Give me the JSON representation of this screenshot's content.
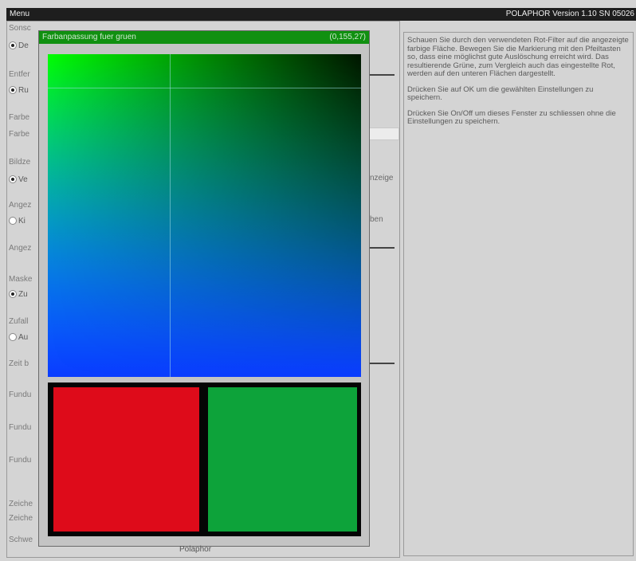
{
  "titlebar": {
    "menu_label": "Menu",
    "version_text": "POLAPHOR Version 1.10 SN 05026"
  },
  "background_labels": [
    "Sonsc",
    "Entfer",
    "Farbe",
    "Farbe",
    "Bildze",
    "Angez",
    "Angez",
    "Maske",
    "Zufall",
    "Zeit b",
    "Fundu",
    "Fundu",
    "Fundu",
    "Zeiche",
    "Zeiche",
    "Schwe"
  ],
  "background_radios": [
    {
      "label": "De",
      "checked": true
    },
    {
      "label": "Ru",
      "checked": true
    },
    {
      "label": "Ve",
      "checked": true
    },
    {
      "label": "Ki",
      "checked": false
    },
    {
      "label": "Zu",
      "checked": true
    },
    {
      "label": "Au",
      "checked": false
    }
  ],
  "background_right_texts": [
    "nzeige",
    "ben"
  ],
  "dialog": {
    "title": "Farbanpassung fuer gruen",
    "value": "(0,155,27)",
    "selected_color": "#0da33a",
    "reference_color": "#de0b1a"
  },
  "help": {
    "paragraphs": [
      "Schauen Sie durch den verwendeten Rot-Filter auf die angezeigte farbige Fläche. Bewegen Sie die Markierung mit den Pfeiltasten so, dass eine möglichst gute Auslöschung erreicht wird. Das resultierende Grüne, zum Vergleich auch das eingestellte Rot, werden auf den unteren Flächen dargestellt.",
      "Drücken Sie auf OK um die gewählten Einstellungen zu speichern.",
      "Drücken Sie On/Off um dieses Fenster zu schliessen ohne die Einstellungen zu speichern."
    ]
  },
  "footer": {
    "label": "Polaphor"
  }
}
